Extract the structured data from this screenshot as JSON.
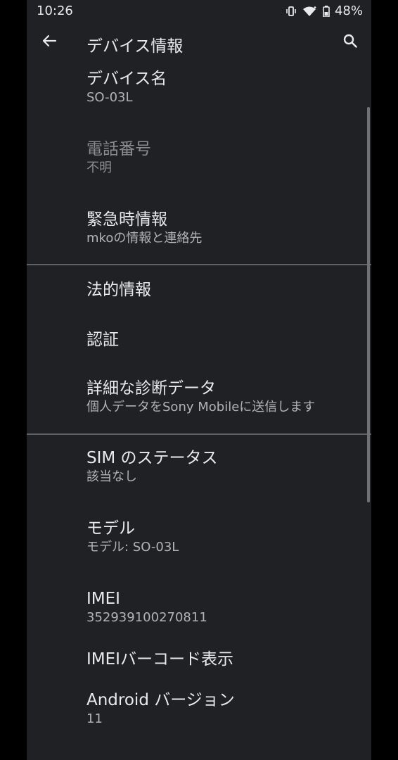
{
  "status_bar": {
    "time": "10:26",
    "battery": "48%"
  },
  "app_bar": {
    "title": "デバイス情報"
  },
  "sections": [
    {
      "items": [
        {
          "title": "デバイス名",
          "summary": "SO-03L",
          "enabled": true
        },
        {
          "title": "電話番号",
          "summary": "不明",
          "enabled": false
        },
        {
          "title": "緊急時情報",
          "summary": "mkoの情報と連絡先",
          "enabled": true
        }
      ]
    },
    {
      "items": [
        {
          "title": "法的情報",
          "summary": "",
          "enabled": true
        },
        {
          "title": "認証",
          "summary": "",
          "enabled": true
        },
        {
          "title": "詳細な診断データ",
          "summary": "個人データをSony Mobileに送信します",
          "enabled": true
        }
      ]
    },
    {
      "items": [
        {
          "title": "SIM のステータス",
          "summary": "該当なし",
          "enabled": true
        },
        {
          "title": "モデル",
          "summary": "モデル: SO-03L",
          "enabled": true
        },
        {
          "title": "IMEI",
          "summary": "352939100270811",
          "enabled": true
        },
        {
          "title": "IMEIバーコード表示",
          "summary": "",
          "enabled": true
        },
        {
          "title": "Android バージョン",
          "summary": "11",
          "enabled": true
        }
      ]
    }
  ],
  "colors": {
    "background": "#202124",
    "text_primary": "#e8eaed",
    "text_secondary": "#b0b3b8",
    "divider": "#5f6368"
  }
}
